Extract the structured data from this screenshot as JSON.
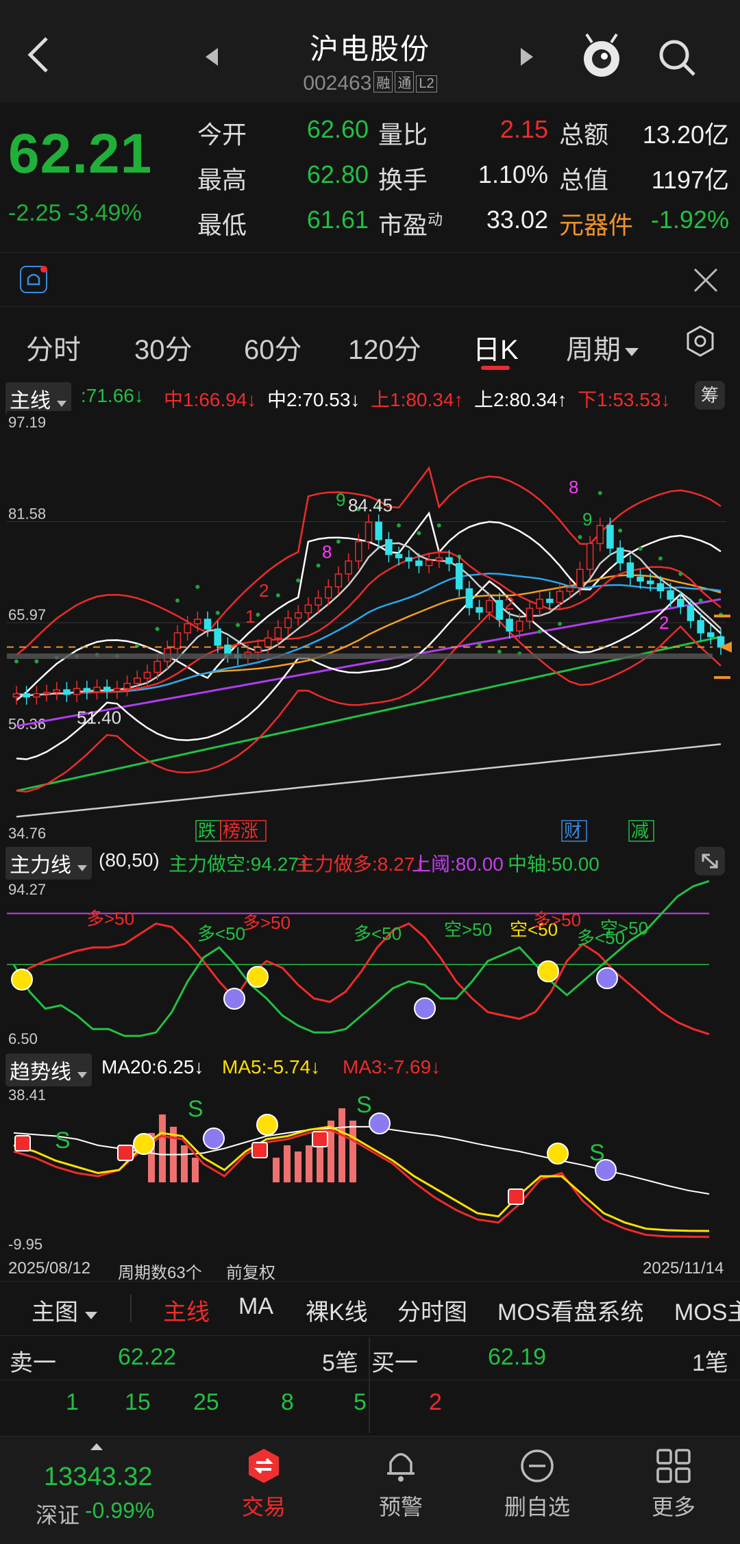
{
  "header": {
    "title": "沪电股份",
    "code": "002463",
    "tags": [
      "融",
      "通",
      "L2"
    ]
  },
  "quote": {
    "price": "62.21",
    "change": "-2.25",
    "change_pct": "-3.49%",
    "rows": [
      [
        {
          "label": "今开",
          "value": "62.60",
          "color": "green"
        },
        {
          "label": "量比",
          "value": "2.15",
          "color": "red"
        },
        {
          "label": "总额",
          "value": "13.20亿",
          "color": "white"
        }
      ],
      [
        {
          "label": "最高",
          "value": "62.80",
          "color": "green"
        },
        {
          "label": "换手",
          "value": "1.10%",
          "color": "white"
        },
        {
          "label": "总值",
          "value": "1197亿",
          "color": "white"
        }
      ],
      [
        {
          "label": "最低",
          "value": "61.61",
          "color": "green"
        },
        {
          "label": "市盈",
          "sup": "动",
          "value": "33.02",
          "color": "white"
        },
        {
          "label": "元器件",
          "value": "-1.92%",
          "color": "green",
          "label_color": "orange"
        }
      ]
    ]
  },
  "period_tabs": [
    "分时",
    "30分",
    "60分",
    "120分",
    "日K",
    "周期"
  ],
  "active_tab": "日K",
  "main_chart": {
    "selector": "主线",
    "legend": [
      {
        "text": ":71.66↓",
        "color": "#22c043"
      },
      {
        "text": "中1:66.94↓",
        "color": "#f02b2b"
      },
      {
        "text": "中2:70.53↓",
        "color": "#ffffff"
      },
      {
        "text": "上1:80.34↑",
        "color": "#f02b2b"
      },
      {
        "text": "上2:80.34↑",
        "color": "#ffffff"
      },
      {
        "text": "下1:53.53↓",
        "color": "#f02b2b"
      }
    ],
    "chip_button": "筹",
    "y_ticks": [
      "97.19",
      "81.58",
      "65.97",
      "50.36",
      "34.76"
    ],
    "annotations": [
      "84.45",
      "51.40"
    ],
    "markers": [
      "跌",
      "榜涨",
      "财",
      "减"
    ]
  },
  "sub1": {
    "selector": "主力线",
    "params": "(80,50)",
    "legend": [
      {
        "text": "主力做空:94.27↑",
        "color": "#22c043"
      },
      {
        "text": "主力做多:8.27↓",
        "color": "#f02b2b"
      },
      {
        "text": "上阈:80.00",
        "color": "#c040f0"
      },
      {
        "text": "中轴:50.00",
        "color": "#22c043"
      }
    ],
    "y_ticks": [
      "94.27",
      "6.50"
    ],
    "labels": [
      {
        "text": "多>50",
        "color": "#f02b2b"
      },
      {
        "text": "多<50",
        "color": "#22c043"
      },
      {
        "text": "多>50",
        "color": "#f02b2b"
      },
      {
        "text": "多<50",
        "color": "#22c043"
      },
      {
        "text": "空>50",
        "color": "#22c043"
      },
      {
        "text": "空<50",
        "color": "#ffe000"
      },
      {
        "text": "多>50",
        "color": "#f02b2b"
      },
      {
        "text": "多<50",
        "color": "#22c043"
      },
      {
        "text": "空>50",
        "color": "#22c043"
      }
    ]
  },
  "sub2": {
    "selector": "趋势线",
    "legend": [
      {
        "text": "MA20:6.25↓",
        "color": "#ffffff"
      },
      {
        "text": "MA5:-5.74↓",
        "color": "#ffe000"
      },
      {
        "text": "MA3:-7.69↓",
        "color": "#f02b2b"
      }
    ],
    "y_ticks": [
      "38.41",
      "-9.95"
    ]
  },
  "footer": {
    "start_date": "2025/08/12",
    "period_count": "周期数63个",
    "adjust": "前复权",
    "end_date": "2025/11/14"
  },
  "bottom_tabs": [
    "主图",
    "主线",
    "MA",
    "裸K线",
    "分时图",
    "MOS看盘系统",
    "MOS主"
  ],
  "orderbook": {
    "sell": {
      "label": "卖一",
      "price": "62.22",
      "count": "5笔"
    },
    "buy": {
      "label": "买一",
      "price": "62.19",
      "count": "1笔"
    },
    "sell_ticks": [
      "1",
      "15",
      "25",
      "8",
      "5"
    ],
    "buy_ticks": [
      "2"
    ]
  },
  "nav": {
    "index_value": "13343.32",
    "index_name": "深证",
    "index_change": "-0.99%",
    "items": [
      {
        "label": "交易",
        "active": true
      },
      {
        "label": "预警"
      },
      {
        "label": "删自选"
      },
      {
        "label": "更多"
      }
    ]
  }
}
